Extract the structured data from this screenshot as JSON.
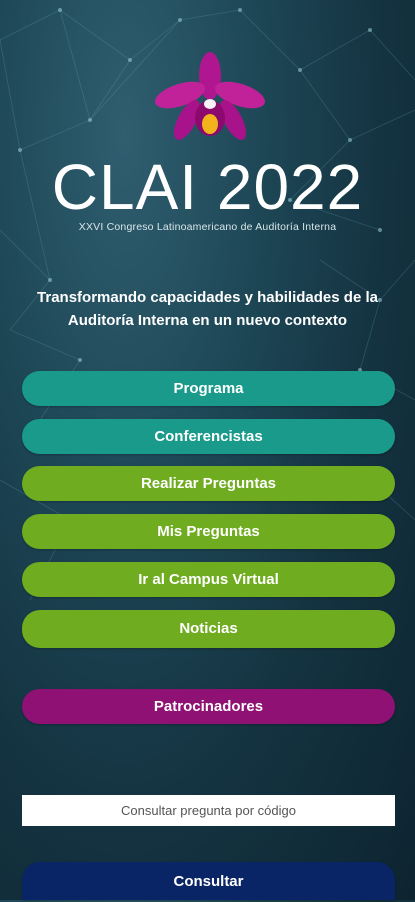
{
  "brand": {
    "name": "CLAI 2022",
    "subtitle": "XXVI Congreso Latinoamericano de Auditoría Interna"
  },
  "tagline": "Transformando capacidades y habilidades de la Auditoría Interna en un nuevo contexto",
  "menu": {
    "programa": "Programa",
    "conferencistas": "Conferencistas",
    "realizar_preguntas": "Realizar Preguntas",
    "mis_preguntas": "Mis Preguntas",
    "campus": "Ir al Campus Virtual",
    "noticias": "Noticias",
    "patrocinadores": "Patrocinadores"
  },
  "search": {
    "placeholder": "Consultar pregunta por código",
    "button": "Consultar"
  },
  "colors": {
    "teal": "#1a9a8a",
    "green": "#6fac20",
    "magenta": "#8f1173",
    "navy": "#0a2566",
    "background": "#163a49"
  },
  "icons": [
    "orchid-logo-icon"
  ]
}
